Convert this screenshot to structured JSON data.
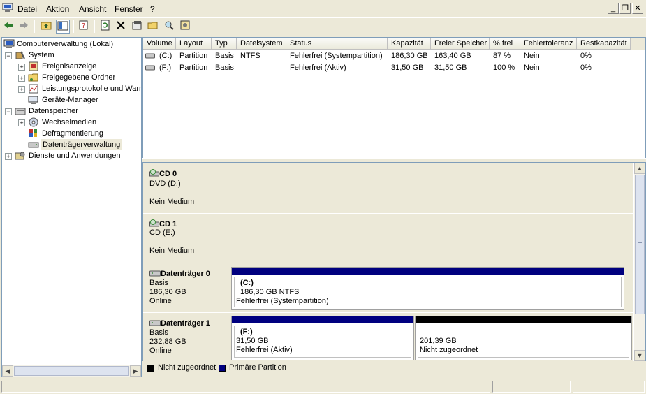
{
  "menu": {
    "items": [
      "Datei",
      "Aktion",
      "Ansicht",
      "Fenster",
      "?"
    ]
  },
  "window_buttons": {
    "minimize": "_",
    "restore": "❐",
    "close": "✕"
  },
  "toolbar": {
    "icons": [
      "back-arrow-icon",
      "forward-arrow-icon",
      "up-folder-icon",
      "show-hide-tree-icon",
      "properties-icon",
      "refresh-icon",
      "delete-icon",
      "properties-sheet-icon",
      "open-folder-icon",
      "search-disk-icon",
      "settings-icon"
    ]
  },
  "tree": {
    "root": "Computerverwaltung (Lokal)",
    "system": "System",
    "ereignis": "Ereignisanzeige",
    "freigegeben": "Freigegebene Ordner",
    "leistung": "Leistungsprotokolle und Warn",
    "geraete": "Geräte-Manager",
    "datenspeicher": "Datenspeicher",
    "wechsel": "Wechselmedien",
    "defrag": "Defragmentierung",
    "datentraeger": "Datenträgerverwaltung",
    "dienste": "Dienste und Anwendungen"
  },
  "volumes": {
    "headers": [
      "Volume",
      "Layout",
      "Typ",
      "Dateisystem",
      "Status",
      "Kapazität",
      "Freier Speicher",
      "% frei",
      "Fehlertoleranz",
      "Restkapazität"
    ],
    "rows": [
      [
        "(C:)",
        "Partition",
        "Basis",
        "NTFS",
        "Fehlerfrei (Systempartition)",
        "186,30 GB",
        "163,40 GB",
        "87 %",
        "Nein",
        "0%"
      ],
      [
        "(F:)",
        "Partition",
        "Basis",
        "",
        "Fehlerfrei (Aktiv)",
        "31,50 GB",
        "31,50 GB",
        "100 %",
        "Nein",
        "0%"
      ]
    ]
  },
  "disks": {
    "cd0": {
      "name": "CD 0",
      "l1": "DVD (D:)",
      "l2": "Kein Medium"
    },
    "cd1": {
      "name": "CD 1",
      "l1": "CD (E:)",
      "l2": "Kein Medium"
    },
    "d0": {
      "name": "Datenträger 0",
      "l1": "Basis",
      "l2": "186,30 GB",
      "l3": "Online",
      "p_name": "(C:)",
      "p_size": "186,30 GB NTFS",
      "p_status": "Fehlerfrei (Systempartition)"
    },
    "d1": {
      "name": "Datenträger 1",
      "l1": "Basis",
      "l2": "232,88 GB",
      "l3": "Online",
      "p1_name": "(F:)",
      "p1_size": "31,50 GB",
      "p1_status": "Fehlerfrei (Aktiv)",
      "p2_size": "201,39 GB",
      "p2_status": "Nicht zugeordnet"
    }
  },
  "legend": {
    "unallocated": "Nicht zugeordnet",
    "primary": "Primäre Partition"
  },
  "colors": {
    "primary": "#00007f",
    "unallocated": "#000000",
    "selection": "#d6d6e8"
  }
}
